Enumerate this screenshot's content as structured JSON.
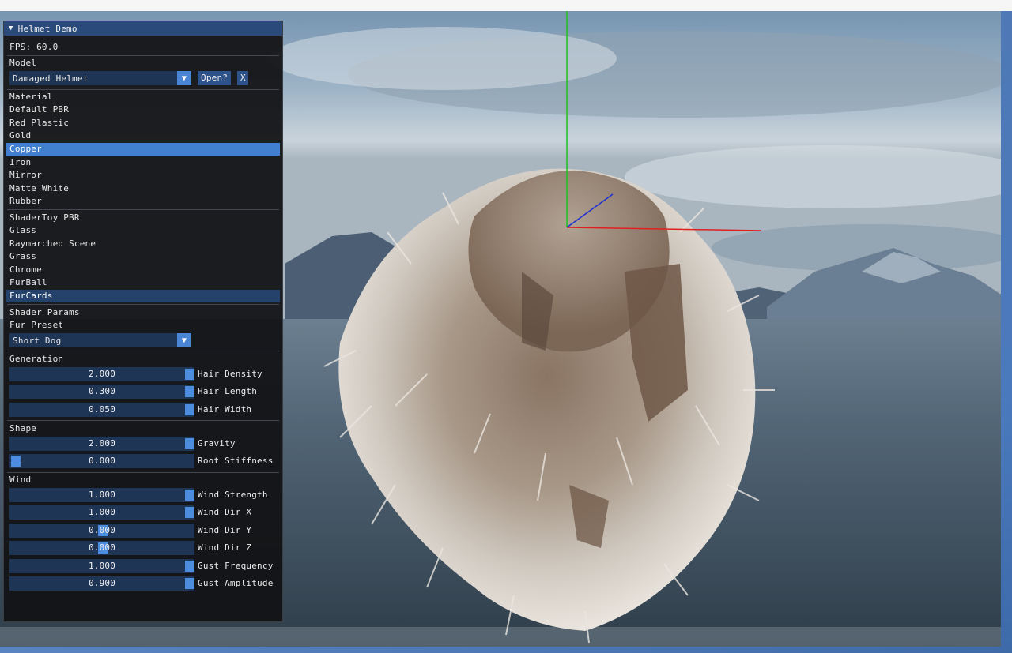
{
  "window": {
    "title": "Helmet Demo",
    "fps_text": "FPS: 60.0"
  },
  "model": {
    "section_label": "Model",
    "selected": "Damaged Helmet",
    "open_label": "Open?",
    "close_label": "X"
  },
  "material": {
    "section_label": "Material",
    "items": [
      {
        "label": "Default PBR"
      },
      {
        "label": "Red Plastic"
      },
      {
        "label": "Gold"
      },
      {
        "label": "Copper"
      },
      {
        "label": "Iron"
      },
      {
        "label": "Mirror"
      },
      {
        "label": "Matte White"
      },
      {
        "label": "Rubber"
      }
    ],
    "selected": "Copper"
  },
  "shadertoy": {
    "items": [
      {
        "label": "ShaderToy PBR"
      },
      {
        "label": "Glass"
      },
      {
        "label": "Raymarched Scene"
      },
      {
        "label": "Grass"
      },
      {
        "label": "Chrome"
      },
      {
        "label": "FurBall"
      },
      {
        "label": "FurCards"
      }
    ],
    "selected": "FurCards"
  },
  "shader_params": {
    "section_label": "Shader Params",
    "preset_label": "Fur Preset",
    "preset_value": "Short Dog"
  },
  "generation": {
    "section_label": "Generation",
    "sliders": [
      {
        "label": "Hair Density",
        "value": "2.000",
        "fraction": 1.0
      },
      {
        "label": "Hair Length",
        "value": "0.300",
        "fraction": 1.0
      },
      {
        "label": "Hair Width",
        "value": "0.050",
        "fraction": 1.0
      }
    ]
  },
  "shape": {
    "section_label": "Shape",
    "sliders": [
      {
        "label": "Gravity",
        "value": "2.000",
        "fraction": 1.0
      },
      {
        "label": "Root Stiffness",
        "value": "0.000",
        "fraction": 0.0
      }
    ]
  },
  "wind": {
    "section_label": "Wind",
    "sliders": [
      {
        "label": "Wind Strength",
        "value": "1.000",
        "fraction": 1.0
      },
      {
        "label": "Wind Dir X",
        "value": "1.000",
        "fraction": 1.0
      },
      {
        "label": "Wind Dir Y",
        "value": "0.000",
        "fraction": 0.5
      },
      {
        "label": "Wind Dir Z",
        "value": "0.000",
        "fraction": 0.5
      },
      {
        "label": "Gust Frequency",
        "value": "1.000",
        "fraction": 1.0
      },
      {
        "label": "Gust Amplitude",
        "value": "0.900",
        "fraction": 1.0
      }
    ]
  },
  "colors": {
    "panel_bg": "#121214",
    "title_bar": "#294a7a",
    "selected_item": "#4180cf",
    "slider_bg": "#1f3556",
    "slider_grab": "#4d8de0",
    "axis_x": "#e02020",
    "axis_y": "#20c020",
    "axis_z": "#2030d0"
  }
}
